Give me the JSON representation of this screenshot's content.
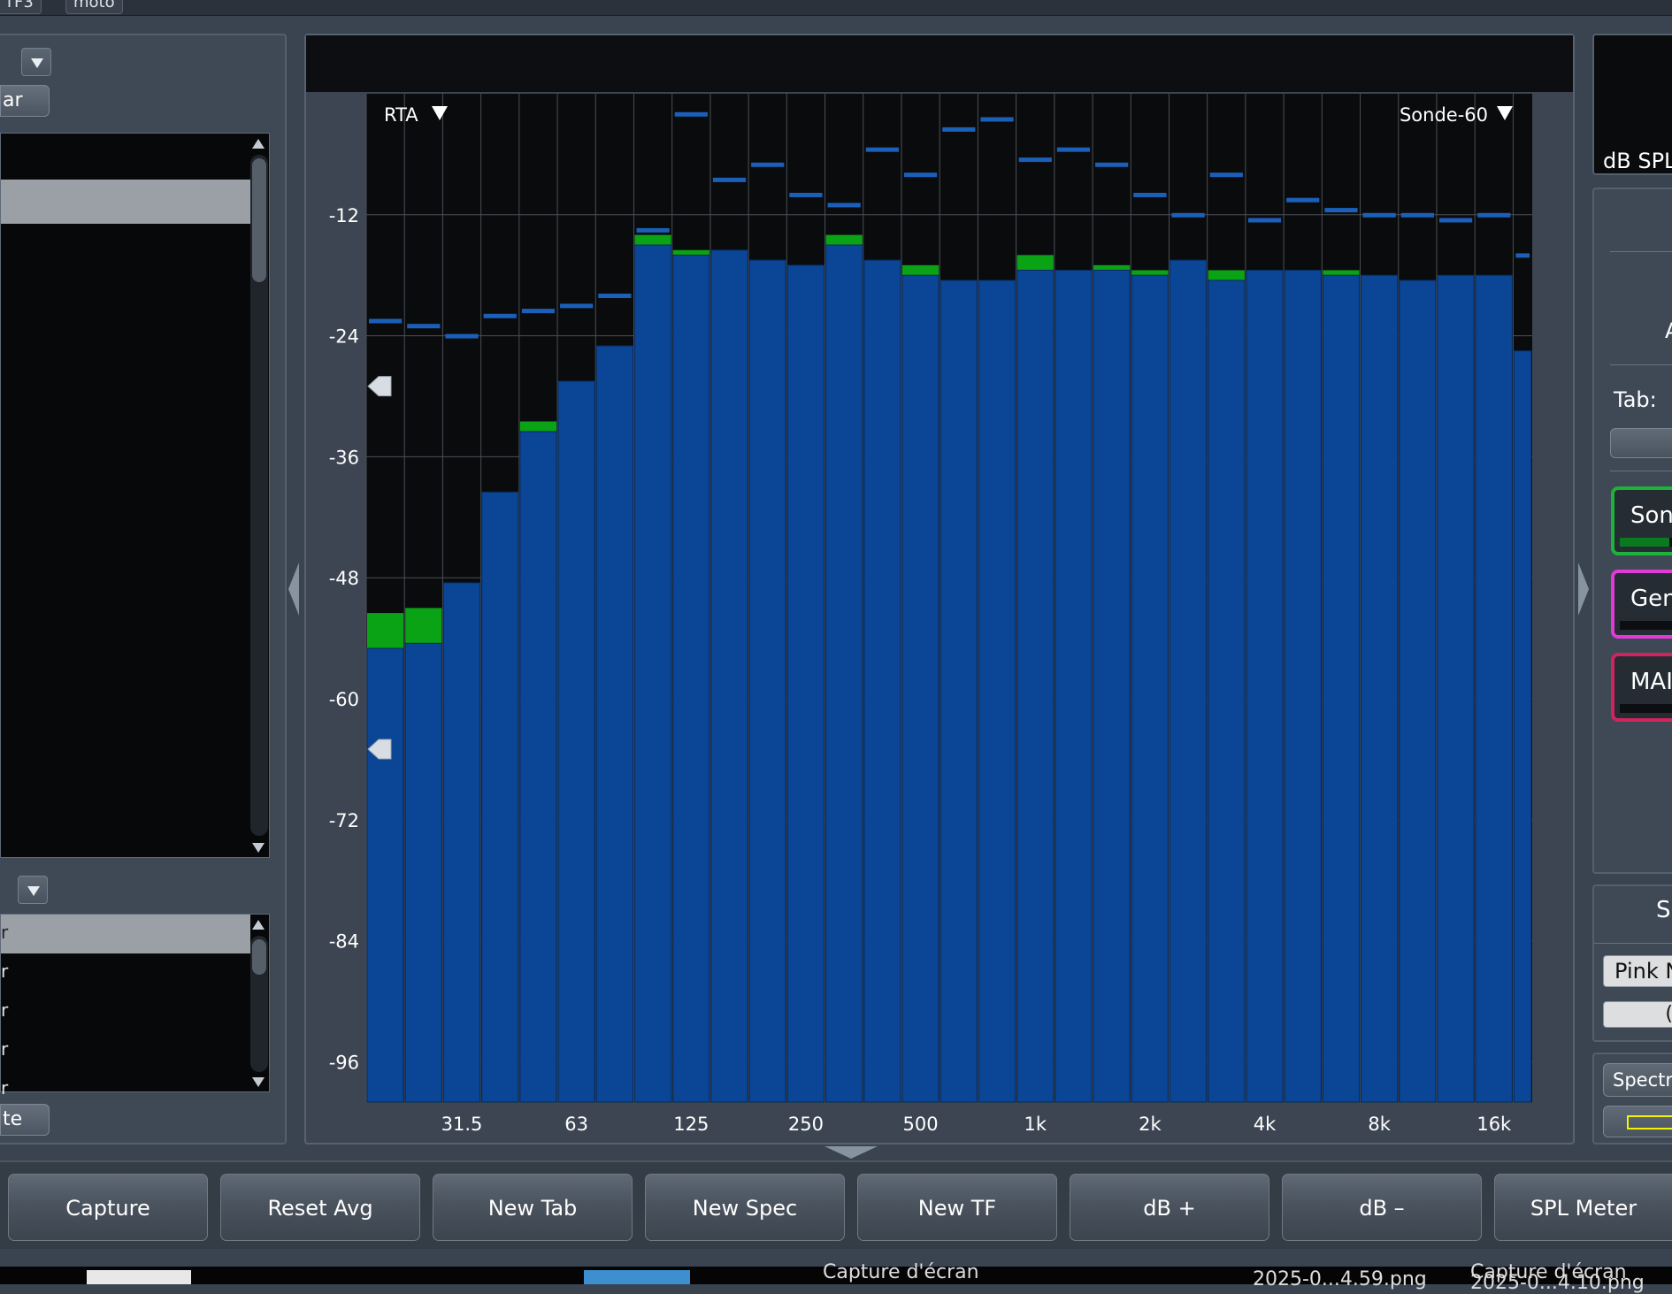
{
  "top_tabs": [
    "TF3",
    "moto"
  ],
  "left_panel": {
    "top_button_label": "ar",
    "bottom_button_label": "te",
    "list2_items": [
      "r",
      "r",
      "r",
      "r",
      "r"
    ]
  },
  "plot": {
    "header_text": "",
    "left_selector": "RTA",
    "right_selector": "Sonde-60"
  },
  "chart_data": {
    "type": "bar",
    "title": "",
    "xlabel": "",
    "ylabel": "",
    "x_tick_labels": [
      "31.5",
      "63",
      "125",
      "250",
      "500",
      "1k",
      "2k",
      "4k",
      "8k",
      "16k"
    ],
    "y_tick_labels": [
      "-12",
      "-24",
      "-36",
      "-48",
      "-60",
      "-72",
      "-84",
      "-96"
    ],
    "ylim": [
      -100,
      0
    ],
    "bands": [
      "20",
      "25",
      "31.5",
      "40",
      "50",
      "63",
      "80",
      "100",
      "125",
      "160",
      "200",
      "250",
      "315",
      "400",
      "500",
      "630",
      "800",
      "1k",
      "1.25k",
      "1.6k",
      "2k",
      "2.5k",
      "3.15k",
      "4k",
      "5k",
      "6.3k",
      "8k",
      "10k",
      "12.5k",
      "16k",
      "20k"
    ],
    "series": [
      {
        "values": [
          -55,
          -54.5,
          -48.5,
          -39.5,
          -33.5,
          -28.5,
          -25,
          -15,
          -16,
          -15.5,
          -16.5,
          -17,
          -15,
          -16.5,
          -18,
          -18.5,
          -18.5,
          -17.5,
          -17.5,
          -17.5,
          -18,
          -16.5,
          -18.5,
          -17.5,
          -17.5,
          -18,
          -18,
          -18.5,
          -18,
          -18,
          -25.5
        ]
      },
      {
        "values": [
          -51.5,
          -51,
          -48.5,
          -39.5,
          -32.5,
          -28.5,
          -25,
          -14,
          -15.5,
          -15.5,
          -16.5,
          -17,
          -14,
          -16.5,
          -17,
          -18.5,
          -18.5,
          -16,
          -17.5,
          -17,
          -17.5,
          -16.5,
          -17.5,
          -17.5,
          -17.5,
          -17.5,
          -18,
          -18.5,
          -18,
          -18,
          -25.5
        ]
      },
      {
        "values": [
          -22.5,
          -23,
          -24,
          -22,
          -21.5,
          -21,
          -20,
          -13.5,
          -2,
          -8.5,
          -7,
          -10,
          -11,
          -5.5,
          -8,
          -3.5,
          -2.5,
          -6.5,
          -5.5,
          -7,
          -10,
          -12,
          -8,
          -12.5,
          -10.5,
          -11.5,
          -12,
          -12,
          -12.5,
          -12,
          -16
        ]
      }
    ],
    "marker_levels": [
      -29,
      -65
    ],
    "colors": {
      "bar": "#0a4596",
      "bar_edge": "#062a5c",
      "peak": "#0aa316",
      "max_hold": "#1b5fb8",
      "grid": "#4a4f57",
      "plot_bg": "#0a0b0c"
    }
  },
  "right_panel": {
    "spl_label": "dB SPL",
    "partial_a": "A",
    "tab_label": "Tab:",
    "sources": [
      {
        "label": "Sonc",
        "color": "#1db23a"
      },
      {
        "label": "Gene",
        "color": "#e03bd6"
      },
      {
        "label": "MAII",
        "color": "#d0245c"
      }
    ],
    "section_label": "SI",
    "noise_box": "Pink N",
    "value_box": "(",
    "spectrum_label": "Spectru"
  },
  "bottom_buttons": [
    "Capture",
    "Reset Avg",
    "New Tab",
    "New Spec",
    "New TF",
    "dB +",
    "dB –",
    "SPL Meter"
  ],
  "os_strip": {
    "t1": "Capture d'écran",
    "t2": "2025-0...4.59.png",
    "t3": "Capture d'écran",
    "t4": "2025-0...4.10.png"
  }
}
